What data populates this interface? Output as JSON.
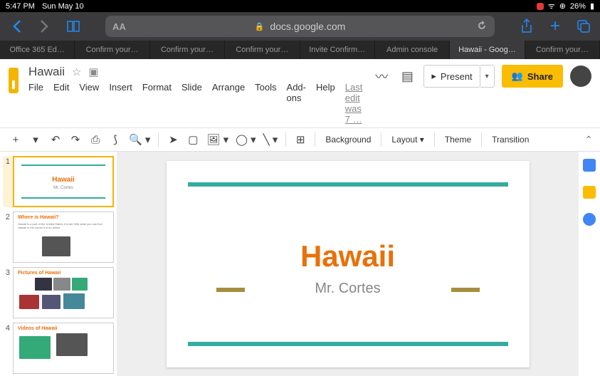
{
  "status": {
    "time": "5:47 PM",
    "date": "Sun May 10",
    "battery": "26%"
  },
  "url": "docs.google.com",
  "aa": "AA",
  "tabs": [
    {
      "label": "Office 365 Ed…",
      "active": false
    },
    {
      "label": "Confirm your…",
      "active": false
    },
    {
      "label": "Confirm your…",
      "active": false
    },
    {
      "label": "Confirm your…",
      "active": false
    },
    {
      "label": "Invite Confirm…",
      "active": false
    },
    {
      "label": "Admin console",
      "active": false
    },
    {
      "label": "Hawaii - Goog…",
      "active": true
    },
    {
      "label": "Confirm your…",
      "active": false
    }
  ],
  "doc": {
    "title": "Hawaii",
    "last_edit": "Last edit was 7 …"
  },
  "menus": [
    "File",
    "Edit",
    "View",
    "Insert",
    "Format",
    "Slide",
    "Arrange",
    "Tools",
    "Add-ons",
    "Help"
  ],
  "actions": {
    "present": "Present",
    "share": "Share"
  },
  "toolbar": {
    "background": "Background",
    "layout": "Layout",
    "theme": "Theme",
    "transition": "Transition"
  },
  "slides": [
    {
      "type": "title",
      "title": "Hawaii",
      "sub": "Mr. Cortes"
    },
    {
      "type": "content",
      "head": "Where is Hawaii?"
    },
    {
      "type": "pictures",
      "head": "Pictures of Hawaii"
    },
    {
      "type": "videos",
      "head": "Videos of Hawaii"
    }
  ],
  "current_slide": {
    "title": "Hawaii",
    "sub": "Mr. Cortes"
  }
}
